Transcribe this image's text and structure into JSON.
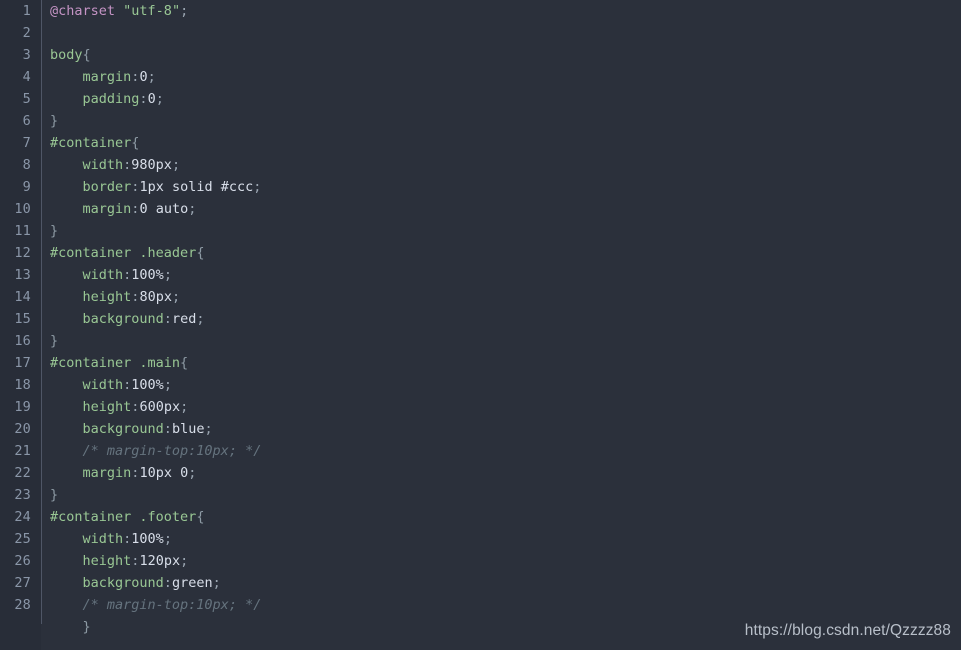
{
  "editor": {
    "language": "CSS",
    "theme": "dark",
    "background_color": "#2b303b",
    "gutter_background_color": "#282d38",
    "line_number_color": "#8a96a8",
    "first_line_number": 1,
    "last_line_number": 28,
    "lines": [
      {
        "number": "1",
        "tokens": [
          {
            "text": "@charset",
            "type": "atrule"
          },
          {
            "text": " ",
            "type": "plain"
          },
          {
            "text": "\"utf-8\"",
            "type": "string"
          },
          {
            "text": ";",
            "type": "punct"
          }
        ]
      },
      {
        "number": "2",
        "tokens": []
      },
      {
        "number": "3",
        "tokens": [
          {
            "text": "body",
            "type": "selector"
          },
          {
            "text": "{",
            "type": "brace"
          }
        ]
      },
      {
        "number": "4",
        "tokens": [
          {
            "text": "    ",
            "type": "plain"
          },
          {
            "text": "margin",
            "type": "prop"
          },
          {
            "text": ":",
            "type": "punct"
          },
          {
            "text": "0",
            "type": "value"
          },
          {
            "text": ";",
            "type": "punct"
          }
        ]
      },
      {
        "number": "5",
        "tokens": [
          {
            "text": "    ",
            "type": "plain"
          },
          {
            "text": "padding",
            "type": "prop"
          },
          {
            "text": ":",
            "type": "punct"
          },
          {
            "text": "0",
            "type": "value"
          },
          {
            "text": ";",
            "type": "punct"
          }
        ]
      },
      {
        "number": "6",
        "tokens": [
          {
            "text": "}",
            "type": "brace"
          }
        ]
      },
      {
        "number": "7",
        "tokens": [
          {
            "text": "#container",
            "type": "selector"
          },
          {
            "text": "{",
            "type": "brace"
          }
        ]
      },
      {
        "number": "8",
        "tokens": [
          {
            "text": "    ",
            "type": "plain"
          },
          {
            "text": "width",
            "type": "prop"
          },
          {
            "text": ":",
            "type": "punct"
          },
          {
            "text": "980px",
            "type": "value"
          },
          {
            "text": ";",
            "type": "punct"
          }
        ]
      },
      {
        "number": "9",
        "tokens": [
          {
            "text": "    ",
            "type": "plain"
          },
          {
            "text": "border",
            "type": "prop"
          },
          {
            "text": ":",
            "type": "punct"
          },
          {
            "text": "1px solid #ccc",
            "type": "value"
          },
          {
            "text": ";",
            "type": "punct"
          }
        ]
      },
      {
        "number": "10",
        "tokens": [
          {
            "text": "    ",
            "type": "plain"
          },
          {
            "text": "margin",
            "type": "prop"
          },
          {
            "text": ":",
            "type": "punct"
          },
          {
            "text": "0 auto",
            "type": "value"
          },
          {
            "text": ";",
            "type": "punct"
          }
        ]
      },
      {
        "number": "11",
        "tokens": [
          {
            "text": "}",
            "type": "brace"
          }
        ]
      },
      {
        "number": "12",
        "tokens": [
          {
            "text": "#container .header",
            "type": "selector"
          },
          {
            "text": "{",
            "type": "brace"
          }
        ]
      },
      {
        "number": "13",
        "tokens": [
          {
            "text": "    ",
            "type": "plain"
          },
          {
            "text": "width",
            "type": "prop"
          },
          {
            "text": ":",
            "type": "punct"
          },
          {
            "text": "100%",
            "type": "value"
          },
          {
            "text": ";",
            "type": "punct"
          }
        ]
      },
      {
        "number": "14",
        "tokens": [
          {
            "text": "    ",
            "type": "plain"
          },
          {
            "text": "height",
            "type": "prop"
          },
          {
            "text": ":",
            "type": "punct"
          },
          {
            "text": "80px",
            "type": "value"
          },
          {
            "text": ";",
            "type": "punct"
          }
        ]
      },
      {
        "number": "15",
        "tokens": [
          {
            "text": "    ",
            "type": "plain"
          },
          {
            "text": "background",
            "type": "prop"
          },
          {
            "text": ":",
            "type": "punct"
          },
          {
            "text": "red",
            "type": "value"
          },
          {
            "text": ";",
            "type": "punct"
          }
        ]
      },
      {
        "number": "16",
        "tokens": [
          {
            "text": "}",
            "type": "brace"
          }
        ]
      },
      {
        "number": "17",
        "tokens": [
          {
            "text": "#container .main",
            "type": "selector"
          },
          {
            "text": "{",
            "type": "brace"
          }
        ]
      },
      {
        "number": "18",
        "tokens": [
          {
            "text": "    ",
            "type": "plain"
          },
          {
            "text": "width",
            "type": "prop"
          },
          {
            "text": ":",
            "type": "punct"
          },
          {
            "text": "100%",
            "type": "value"
          },
          {
            "text": ";",
            "type": "punct"
          }
        ]
      },
      {
        "number": "19",
        "tokens": [
          {
            "text": "    ",
            "type": "plain"
          },
          {
            "text": "height",
            "type": "prop"
          },
          {
            "text": ":",
            "type": "punct"
          },
          {
            "text": "600px",
            "type": "value"
          },
          {
            "text": ";",
            "type": "punct"
          }
        ]
      },
      {
        "number": "20",
        "tokens": [
          {
            "text": "    ",
            "type": "plain"
          },
          {
            "text": "background",
            "type": "prop"
          },
          {
            "text": ":",
            "type": "punct"
          },
          {
            "text": "blue",
            "type": "value"
          },
          {
            "text": ";",
            "type": "punct"
          }
        ]
      },
      {
        "number": "21",
        "tokens": [
          {
            "text": "    ",
            "type": "plain"
          },
          {
            "text": "/* margin-top:10px; */",
            "type": "comment"
          }
        ]
      },
      {
        "number": "22",
        "tokens": [
          {
            "text": "    ",
            "type": "plain"
          },
          {
            "text": "margin",
            "type": "prop"
          },
          {
            "text": ":",
            "type": "punct"
          },
          {
            "text": "10px 0",
            "type": "value"
          },
          {
            "text": ";",
            "type": "punct"
          }
        ]
      },
      {
        "number": "23",
        "tokens": [
          {
            "text": "}",
            "type": "brace"
          }
        ]
      },
      {
        "number": "24",
        "tokens": [
          {
            "text": "#container .footer",
            "type": "selector"
          },
          {
            "text": "{",
            "type": "brace"
          }
        ]
      },
      {
        "number": "25",
        "tokens": [
          {
            "text": "    ",
            "type": "plain"
          },
          {
            "text": "width",
            "type": "prop"
          },
          {
            "text": ":",
            "type": "punct"
          },
          {
            "text": "100%",
            "type": "value"
          },
          {
            "text": ";",
            "type": "punct"
          }
        ]
      },
      {
        "number": "26",
        "tokens": [
          {
            "text": "    ",
            "type": "plain"
          },
          {
            "text": "height",
            "type": "prop"
          },
          {
            "text": ":",
            "type": "punct"
          },
          {
            "text": "120px",
            "type": "value"
          },
          {
            "text": ";",
            "type": "punct"
          }
        ]
      },
      {
        "number": "27",
        "tokens": [
          {
            "text": "    ",
            "type": "plain"
          },
          {
            "text": "background",
            "type": "prop"
          },
          {
            "text": ":",
            "type": "punct"
          },
          {
            "text": "green",
            "type": "value"
          },
          {
            "text": ";",
            "type": "punct"
          }
        ]
      },
      {
        "number": "28",
        "tokens": [
          {
            "text": "    ",
            "type": "plain"
          },
          {
            "text": "/* margin-top:10px; */",
            "type": "comment"
          }
        ]
      },
      {
        "number": "",
        "tokens": [
          {
            "text": "    ",
            "type": "plain"
          },
          {
            "text": "}",
            "type": "brace"
          }
        ]
      }
    ]
  },
  "watermark": {
    "text": "https://blog.csdn.net/Qzzzz88",
    "color": "#b8bfc9"
  }
}
